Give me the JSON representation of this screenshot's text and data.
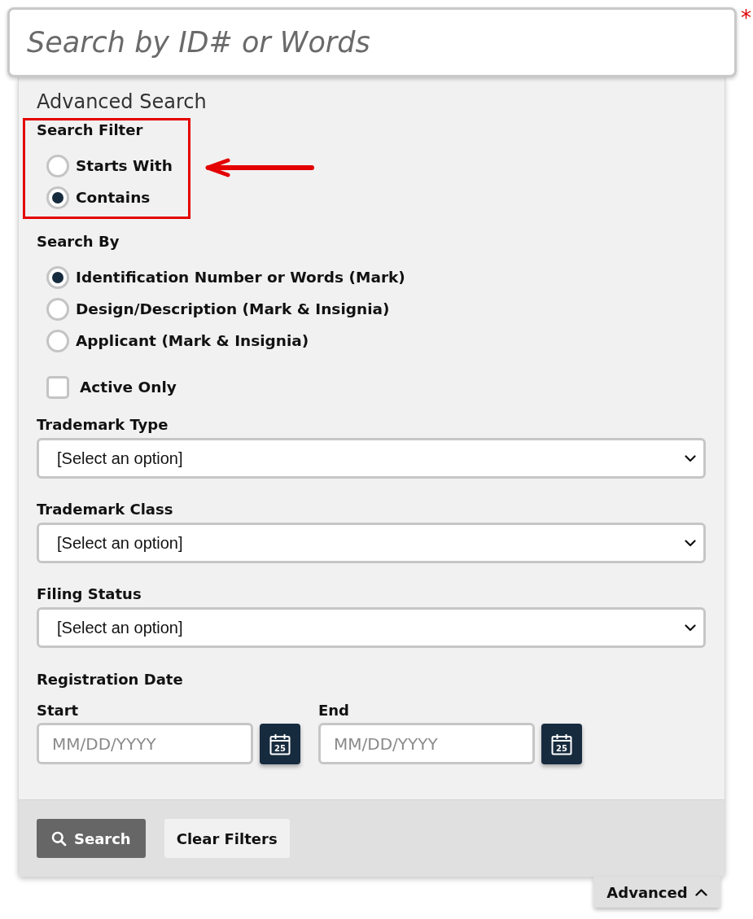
{
  "search": {
    "placeholder": "Search by ID# or Words",
    "required_mark": "*"
  },
  "advanced_search": {
    "title": "Advanced Search",
    "search_filter": {
      "label": "Search Filter",
      "highlighted": true,
      "options": [
        {
          "label": "Starts With",
          "selected": false
        },
        {
          "label": "Contains",
          "selected": true
        }
      ]
    },
    "search_by": {
      "label": "Search By",
      "options": [
        {
          "label": "Identification Number or Words (Mark)",
          "selected": true
        },
        {
          "label": "Design/Description (Mark & Insignia)",
          "selected": false
        },
        {
          "label": "Applicant (Mark & Insignia)",
          "selected": false
        }
      ]
    },
    "active_only": {
      "label": "Active Only",
      "checked": false
    },
    "selects": [
      {
        "label": "Trademark Type",
        "value": "[Select an option]"
      },
      {
        "label": "Trademark Class",
        "value": "[Select an option]"
      },
      {
        "label": "Filing Status",
        "value": "[Select an option]"
      }
    ],
    "registration_date": {
      "label": "Registration Date",
      "fields": [
        {
          "label": "Start",
          "placeholder": "MM/DD/YYYY",
          "calendar_day": "25"
        },
        {
          "label": "End",
          "placeholder": "MM/DD/YYYY",
          "calendar_day": "25"
        }
      ]
    },
    "buttons": [
      {
        "kind": "primary",
        "label": "Search"
      },
      {
        "kind": "secondary",
        "label": "Clear Filters"
      }
    ]
  },
  "advanced_toggle": {
    "label": "Advanced",
    "expanded": true
  }
}
